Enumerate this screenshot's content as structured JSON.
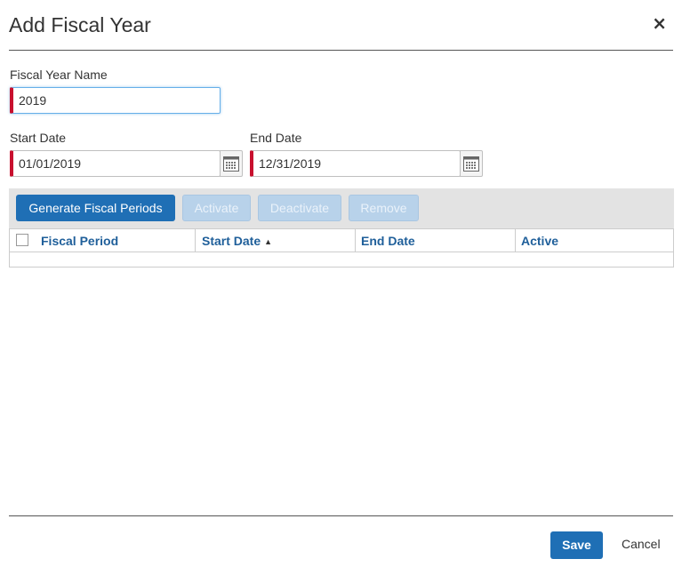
{
  "dialog": {
    "title": "Add Fiscal Year",
    "close_symbol": "×"
  },
  "form": {
    "fiscal_year_name": {
      "label": "Fiscal Year Name",
      "value": "2019"
    },
    "start_date": {
      "label": "Start Date",
      "value": "01/01/2019"
    },
    "end_date": {
      "label": "End Date",
      "value": "12/31/2019"
    }
  },
  "toolbar": {
    "generate_label": "Generate Fiscal Periods",
    "activate_label": "Activate",
    "deactivate_label": "Deactivate",
    "remove_label": "Remove"
  },
  "grid": {
    "columns": [
      "Fiscal Period",
      "Start Date",
      "End Date",
      "Active"
    ],
    "sort_indicator": "▲",
    "rows": []
  },
  "footer": {
    "save_label": "Save",
    "cancel_label": "Cancel"
  },
  "colors": {
    "primary": "#1f6fb5",
    "required": "#c8102e",
    "toolbar_bg": "#e3e3e3"
  }
}
